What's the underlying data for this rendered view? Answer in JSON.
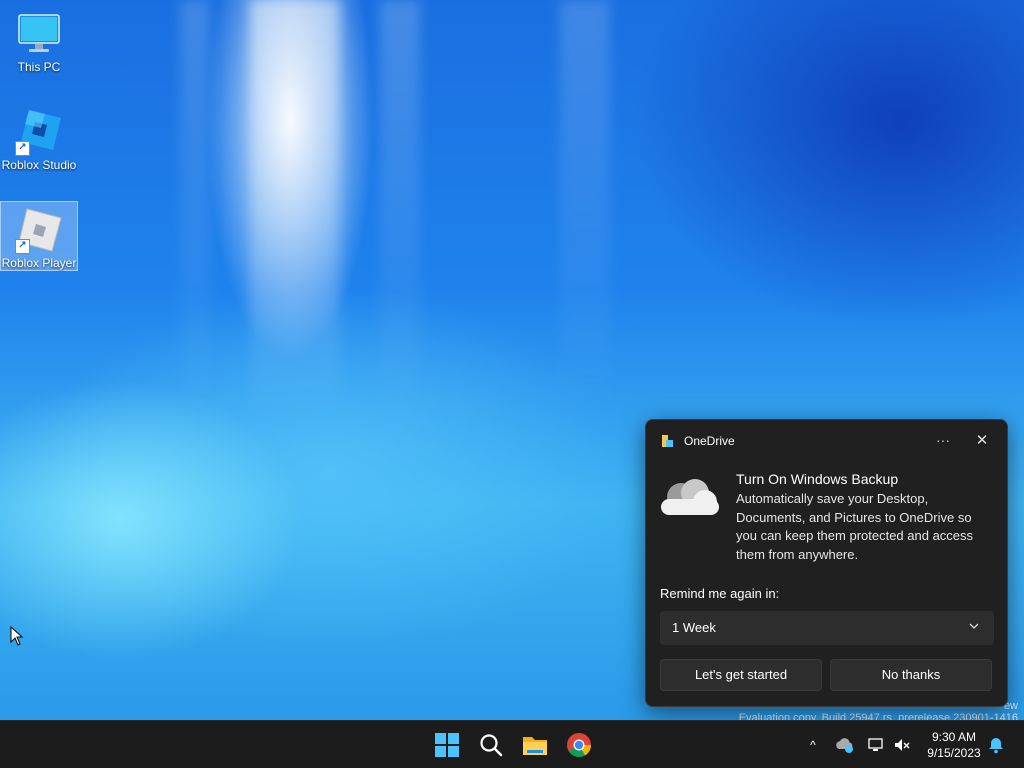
{
  "desktop": {
    "icons": [
      {
        "label": "This PC",
        "icon": "monitor-icon"
      },
      {
        "label": "Roblox Studio",
        "icon": "roblox-studio-icon"
      },
      {
        "label": "Roblox Player",
        "icon": "roblox-player-icon"
      }
    ],
    "watermark_line1": "ew",
    "watermark_line2": "Evaluation copy. Build 25947.rs_prerelease.230901-1416"
  },
  "toast": {
    "app_name": "OneDrive",
    "more_glyph": "···",
    "close_glyph": "✕",
    "title": "Turn On Windows Backup",
    "body": "Automatically save your Desktop, Documents, and Pictures to OneDrive so you can keep them protected and access them from anywhere.",
    "remind_label": "Remind me again in:",
    "remind_value": "1 Week",
    "primary_button": "Let's get started",
    "secondary_button": "No thanks"
  },
  "taskbar": {
    "pinned": [
      "start-icon",
      "search-icon",
      "file-explorer-icon",
      "chrome-icon"
    ],
    "tray_overflow_glyph": "^",
    "time": "9:30 AM",
    "date": "9/15/2023"
  },
  "colors": {
    "toast_bg": "#202020",
    "button_bg": "#2d2d2d",
    "taskbar_bg": "#1c1c1c",
    "accent": "#4cc2ff"
  }
}
